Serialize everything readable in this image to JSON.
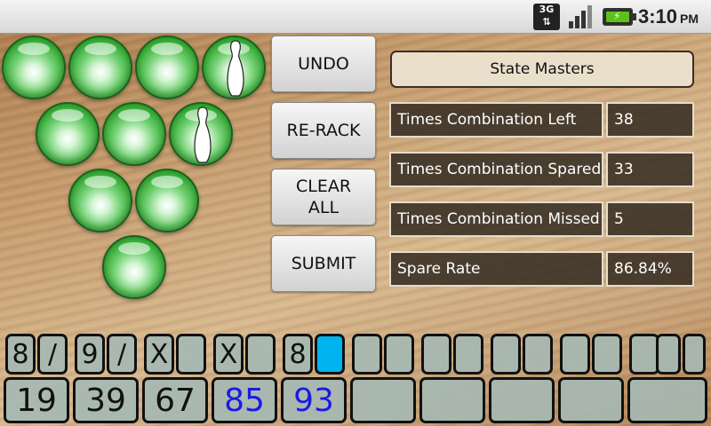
{
  "status_bar": {
    "network": "3G",
    "time": "3:10",
    "ampm": "PM"
  },
  "pins": [
    {
      "id": 7,
      "standing": false
    },
    {
      "id": 8,
      "standing": false
    },
    {
      "id": 9,
      "standing": false
    },
    {
      "id": 10,
      "standing": true
    },
    {
      "id": 4,
      "standing": false
    },
    {
      "id": 5,
      "standing": false
    },
    {
      "id": 6,
      "standing": true
    },
    {
      "id": 2,
      "standing": false
    },
    {
      "id": 3,
      "standing": false
    },
    {
      "id": 1,
      "standing": false
    }
  ],
  "buttons": {
    "undo": "UNDO",
    "rerack": "RE-RACK",
    "clear_all_line1": "CLEAR",
    "clear_all_line2": "ALL",
    "submit": "SUBMIT"
  },
  "stats": {
    "league": "State Masters",
    "rows": [
      {
        "label": "Times Combination Left",
        "value": "38"
      },
      {
        "label": "Times Combination Spared",
        "value": "33"
      },
      {
        "label": "Times Combination Missed",
        "value": "5"
      },
      {
        "label": "Spare Rate",
        "value": "86.84%"
      }
    ]
  },
  "scoresheet": {
    "balls": [
      "8",
      "/",
      "9",
      "/",
      "X",
      "",
      "X",
      "",
      "8",
      "",
      "",
      "",
      "",
      "",
      "",
      "",
      "",
      "",
      "",
      "",
      ""
    ],
    "active_ball_index": 9,
    "totals": [
      "19",
      "39",
      "67",
      "85",
      "93",
      "",
      "",
      "",
      "",
      ""
    ],
    "blue_totals": [
      3,
      4
    ],
    "colors": {
      "box_bg": "#a5b9b4",
      "active": "#00b4f0",
      "blue_text": "#1a1ae6",
      "pin_green": "#2fa52f"
    }
  }
}
